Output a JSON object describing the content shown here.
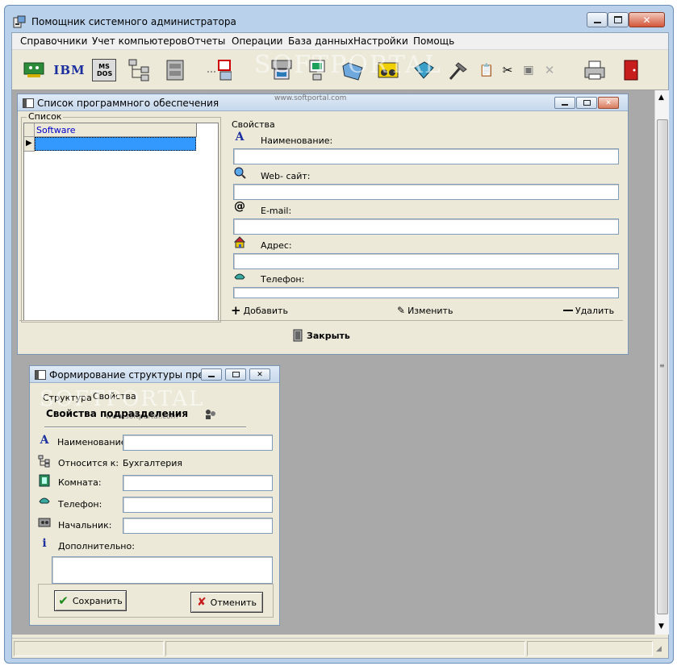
{
  "app": {
    "title": "Помощник системного администратора"
  },
  "menu": [
    {
      "label": "Справочники"
    },
    {
      "label": "Учет компьютеров"
    },
    {
      "label": "Отчеты"
    },
    {
      "label": "Операции"
    },
    {
      "label": "База данных"
    },
    {
      "label": "Настройки"
    },
    {
      "label": "Помощь"
    }
  ],
  "toolbar": {
    "ibm_text": "IBM",
    "msdos_text": "MS DOS"
  },
  "watermark": {
    "text": "SOFTPORTAL",
    "url": "www.softportal.com"
  },
  "software_window": {
    "title": "Список программного обеспечения",
    "list_group_label": "Список",
    "grid_column": "Software",
    "grid_row_marker": "▶",
    "props_group_label": "Свойства",
    "fields": {
      "name_label": "Наименование:",
      "web_label": "Web- сайт:",
      "email_label": "E-mail:",
      "address_label": "Адрес:",
      "phone_label": "Телефон:"
    },
    "buttons": {
      "add": "Добавить",
      "edit": "Изменить",
      "delete": "Удалить",
      "close": "Закрыть"
    }
  },
  "structure_window": {
    "title": "Формирование структуры пре...",
    "tab_structure": "Структура",
    "tab_properties": "Свойства",
    "heading": "Свойства подразделения",
    "fields": {
      "name_label": "Наименование:",
      "parent_label": "Относится к:",
      "parent_value": "Бухгалтерия",
      "room_label": "Комната:",
      "phone_label": "Телефон:",
      "chief_label": "Начальник:",
      "extra_label": "Дополнительно:"
    },
    "buttons": {
      "save": "Сохранить",
      "cancel": "Отменить"
    }
  },
  "colors": {
    "accent_blue": "#0000cc",
    "grid_selected": "#3399ff",
    "frame": "#b9d1ea",
    "close_red": "#d97c5f"
  }
}
